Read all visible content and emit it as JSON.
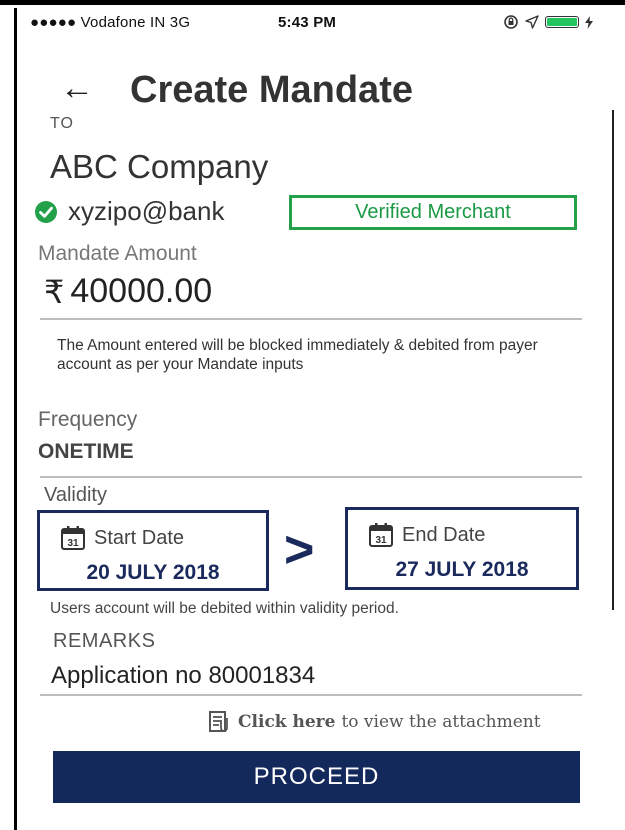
{
  "status_bar": {
    "carrier": "●●●●● Vodafone IN  3G",
    "time": "5:43 PM",
    "icons": [
      "lock-rotation-icon",
      "location-arrow-icon",
      "battery-icon"
    ]
  },
  "header": {
    "back_icon": "←",
    "title": "Create Mandate"
  },
  "payee": {
    "to_label": "TO",
    "name": "ABC Company",
    "vpa": "xyzipo@bank",
    "verified_label": "Verified Merchant"
  },
  "amount": {
    "label": "Mandate Amount",
    "currency_symbol": "₹",
    "value": "40000.00",
    "note": "The Amount entered will be blocked immediately & debited from payer account as per your Mandate inputs"
  },
  "frequency": {
    "label": "Frequency",
    "value": "ONETIME"
  },
  "validity": {
    "label": "Validity",
    "start_label": "Start Date",
    "start_value": "20 JULY 2018",
    "end_label": "End Date",
    "end_value": "27 JULY 2018",
    "calendar_day": "31",
    "separator": ">",
    "note": "Users account will be debited within validity period."
  },
  "remarks": {
    "label": "REMARKS",
    "value": "Application no 80001834"
  },
  "attachment": {
    "link_text": "Click here",
    "suffix": "to view the attachment"
  },
  "actions": {
    "proceed_label": "PROCEED"
  },
  "colors": {
    "primary": "#13285b",
    "verified_green": "#22a04a",
    "battery": "#22c55e"
  }
}
